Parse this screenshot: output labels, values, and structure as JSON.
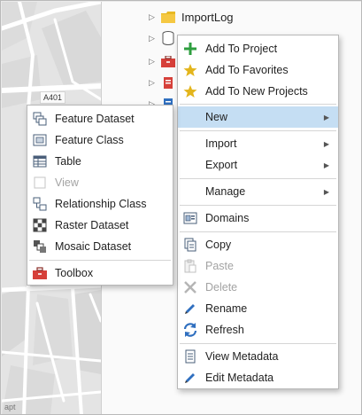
{
  "map": {
    "road_label": "A401",
    "edge_text": "apt"
  },
  "catalog": {
    "visible_item": "ImportLog"
  },
  "context_menu": {
    "items": [
      {
        "id": "add-to-project",
        "label": "Add To Project",
        "icon": "plus-icon",
        "disabled": false,
        "submenu": false
      },
      {
        "id": "add-to-favorites",
        "label": "Add To Favorites",
        "icon": "star-icon",
        "disabled": false,
        "submenu": false
      },
      {
        "id": "add-to-new-projects",
        "label": "Add To New Projects",
        "icon": "star-icon",
        "disabled": false,
        "submenu": false
      },
      {
        "id": "new",
        "label": "New",
        "icon": "",
        "disabled": false,
        "submenu": true,
        "highlighted": true
      },
      {
        "id": "import",
        "label": "Import",
        "icon": "",
        "disabled": false,
        "submenu": true
      },
      {
        "id": "export",
        "label": "Export",
        "icon": "",
        "disabled": false,
        "submenu": true
      },
      {
        "id": "manage",
        "label": "Manage",
        "icon": "",
        "disabled": false,
        "submenu": true
      },
      {
        "id": "domains",
        "label": "Domains",
        "icon": "domains-icon",
        "disabled": false,
        "submenu": false
      },
      {
        "id": "copy",
        "label": "Copy",
        "icon": "copy-icon",
        "disabled": false,
        "submenu": false
      },
      {
        "id": "paste",
        "label": "Paste",
        "icon": "paste-icon",
        "disabled": true,
        "submenu": false
      },
      {
        "id": "delete",
        "label": "Delete",
        "icon": "delete-icon",
        "disabled": true,
        "submenu": false
      },
      {
        "id": "rename",
        "label": "Rename",
        "icon": "pencil-icon",
        "disabled": false,
        "submenu": false
      },
      {
        "id": "refresh",
        "label": "Refresh",
        "icon": "refresh-icon",
        "disabled": false,
        "submenu": false
      },
      {
        "id": "view-metadata",
        "label": "View Metadata",
        "icon": "metadata-icon",
        "disabled": false,
        "submenu": false
      },
      {
        "id": "edit-metadata",
        "label": "Edit Metadata",
        "icon": "pencil-icon",
        "disabled": false,
        "submenu": false
      }
    ]
  },
  "new_submenu": {
    "items": [
      {
        "id": "feature-dataset",
        "label": "Feature Dataset",
        "icon": "feature-dataset-icon",
        "disabled": false
      },
      {
        "id": "feature-class",
        "label": "Feature Class",
        "icon": "feature-class-icon",
        "disabled": false
      },
      {
        "id": "table",
        "label": "Table",
        "icon": "table-icon",
        "disabled": false
      },
      {
        "id": "view",
        "label": "View",
        "icon": "view-icon",
        "disabled": true
      },
      {
        "id": "relationship-class",
        "label": "Relationship Class",
        "icon": "relationship-class-icon",
        "disabled": false
      },
      {
        "id": "raster-dataset",
        "label": "Raster Dataset",
        "icon": "raster-dataset-icon",
        "disabled": false
      },
      {
        "id": "mosaic-dataset",
        "label": "Mosaic Dataset",
        "icon": "mosaic-dataset-icon",
        "disabled": false
      },
      {
        "id": "toolbox",
        "label": "Toolbox",
        "icon": "toolbox-icon",
        "disabled": false
      }
    ]
  },
  "colors": {
    "highlight": "#c5def3",
    "plus_green": "#2e9e3f",
    "star_gold": "#e3b51c",
    "blue_icon": "#2f6fbf",
    "toolbox_red": "#d6403a"
  }
}
